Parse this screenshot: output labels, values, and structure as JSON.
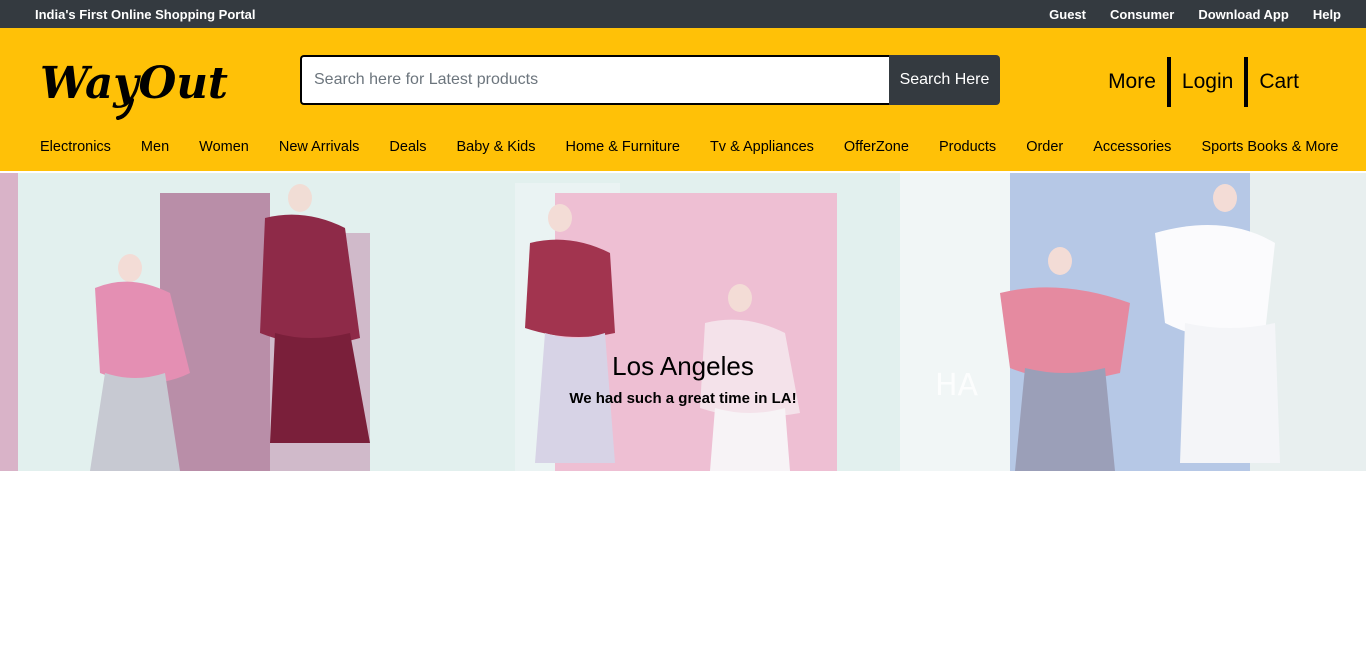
{
  "topbar": {
    "tagline": "India's First Online Shopping Portal",
    "links": [
      "Guest",
      "Consumer",
      "Download App",
      "Help"
    ]
  },
  "header": {
    "logo_text": "WayOut",
    "search": {
      "placeholder": "Search here for Latest products",
      "value": "",
      "button_label": "Search Here"
    },
    "right_links": [
      "More",
      "Login",
      "Cart"
    ]
  },
  "categories": [
    "Electronics",
    "Men",
    "Women",
    "New Arrivals",
    "Deals",
    "Baby & Kids",
    "Home & Furniture",
    "Tv & Appliances",
    "OfferZone",
    "Products",
    "Order",
    "Accessories",
    "Sports Books & More"
  ],
  "hero": {
    "title": "Los Angeles",
    "subtitle": "We had such a great time in LA!"
  },
  "colors": {
    "accent": "#ffc107",
    "dark": "#343a40"
  }
}
